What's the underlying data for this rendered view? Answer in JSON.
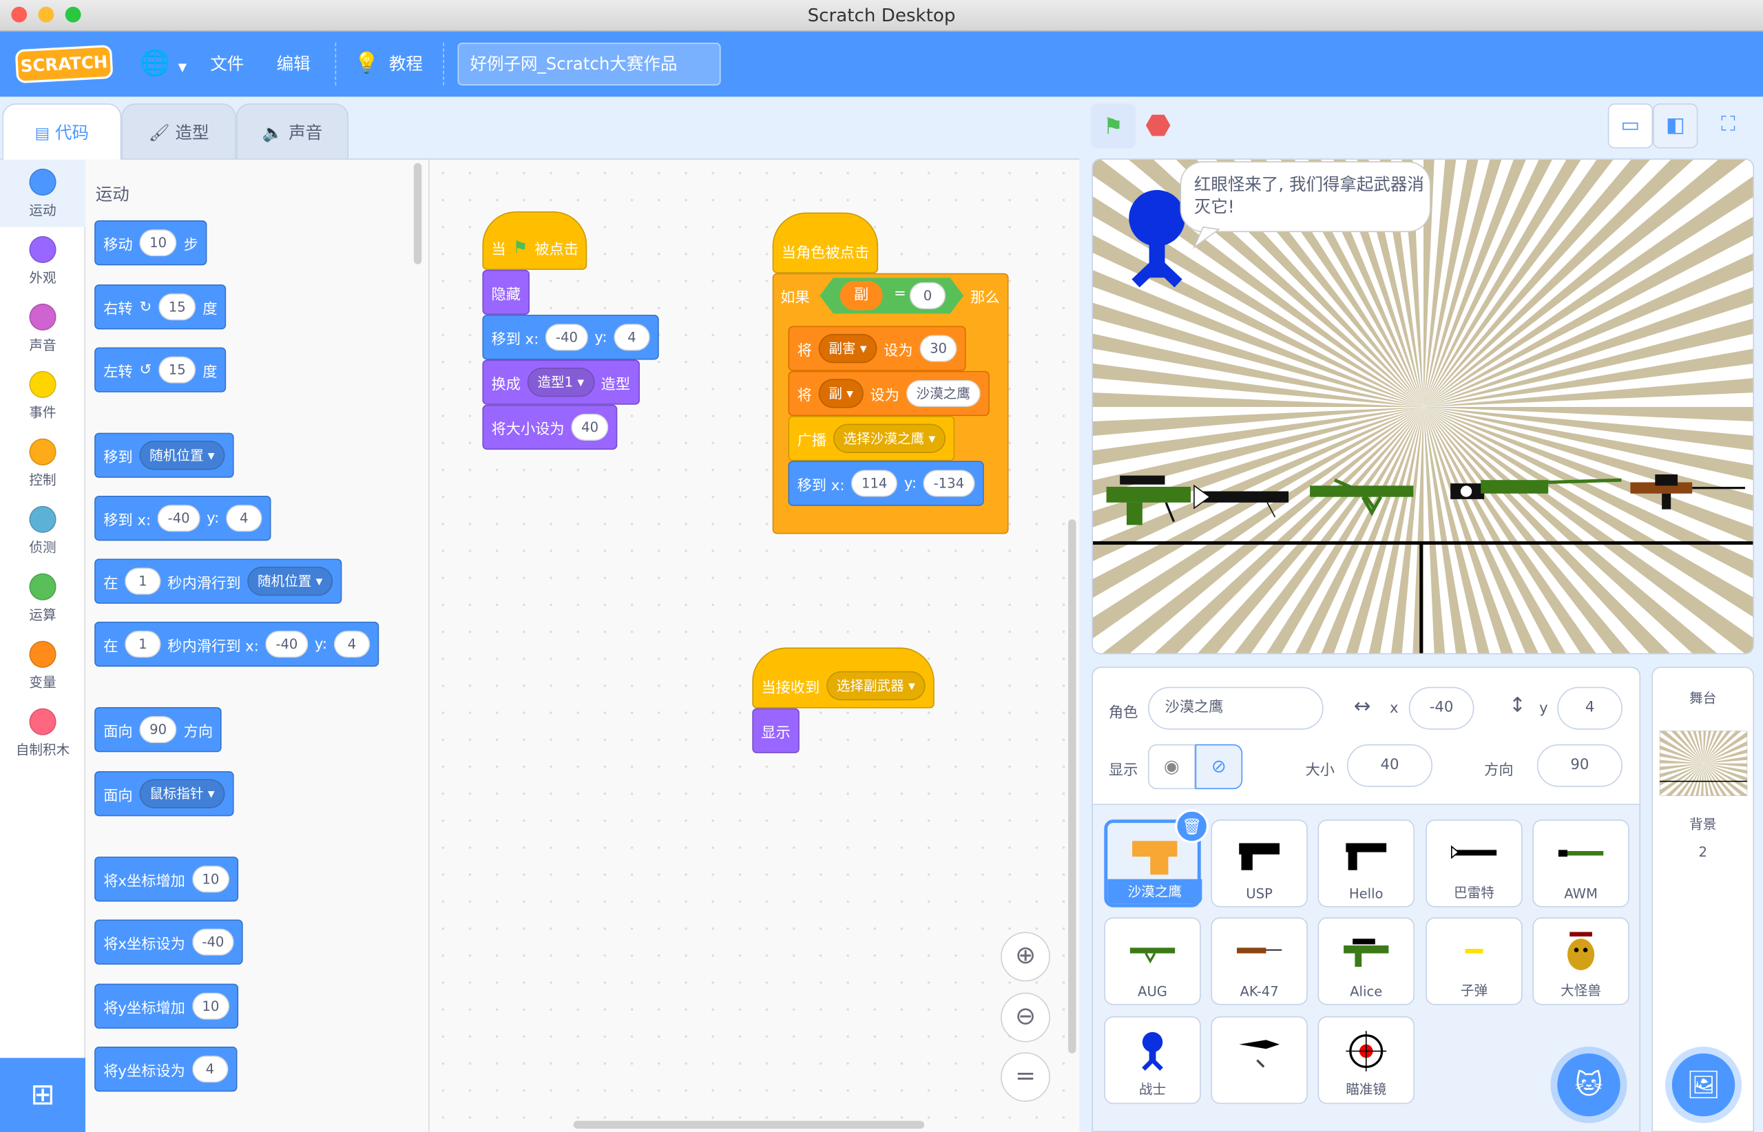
{
  "window": {
    "title": "Scratch Desktop"
  },
  "menu": {
    "logo": "SCRATCH",
    "language_icon": "globe-icon",
    "file": "文件",
    "edit": "编辑",
    "tutorials": "教程",
    "project_title": "好例子网_Scratch大赛作品"
  },
  "tabs": {
    "code": "代码",
    "costumes": "造型",
    "sounds": "声音"
  },
  "categories": [
    {
      "label": "运动",
      "color": "#4c97ff"
    },
    {
      "label": "外观",
      "color": "#9966ff"
    },
    {
      "label": "声音",
      "color": "#cf63cf"
    },
    {
      "label": "事件",
      "color": "#ffd500"
    },
    {
      "label": "控制",
      "color": "#ffab19"
    },
    {
      "label": "侦测",
      "color": "#5cb1d6"
    },
    {
      "label": "运算",
      "color": "#59c059"
    },
    {
      "label": "变量",
      "color": "#ff8c1a"
    },
    {
      "label": "自制积木",
      "color": "#ff6680"
    }
  ],
  "palette": {
    "heading": "运动",
    "move": {
      "a": "移动",
      "n": "10",
      "b": "步"
    },
    "turn_right": {
      "a": "右转",
      "n": "15",
      "b": "度"
    },
    "turn_left": {
      "a": "左转",
      "n": "15",
      "b": "度"
    },
    "goto": {
      "a": "移到",
      "dd": "随机位置"
    },
    "goto_xy": {
      "a": "移到 x:",
      "x": "-40",
      "y_label": "y:",
      "y": "4"
    },
    "glide_random": {
      "a": "在",
      "n": "1",
      "b": "秒内滑行到",
      "dd": "随机位置"
    },
    "glide_xy": {
      "a": "在",
      "n": "1",
      "b": "秒内滑行到 x:",
      "x": "-40",
      "y_label": "y:",
      "y": "4"
    },
    "point_dir": {
      "a": "面向",
      "n": "90",
      "b": "方向"
    },
    "point_towards": {
      "a": "面向",
      "dd": "鼠标指针"
    },
    "change_x": {
      "a": "将x坐标增加",
      "n": "10"
    },
    "set_x": {
      "a": "将x坐标设为",
      "n": "-40"
    },
    "change_y": {
      "a": "将y坐标增加",
      "n": "10"
    },
    "set_y": {
      "a": "将y坐标设为",
      "n": "4"
    }
  },
  "scripts": {
    "s1": {
      "hat_a": "当",
      "hat_b": "被点击",
      "hide": "隐藏",
      "goto_a": "移到 x:",
      "x": "-40",
      "y_label": "y:",
      "y": "4",
      "costume_a": "换成",
      "costume_dd": "造型1",
      "costume_b": "造型",
      "size_a": "将大小设为",
      "size": "40"
    },
    "s2": {
      "hat": "当角色被点击",
      "if_a": "如果",
      "var": "副",
      "eq": "=",
      "val": "0",
      "then": "那么",
      "set1_a": "将",
      "set1_dd": "副害",
      "set1_b": "设为",
      "set1_v": "30",
      "set2_a": "将",
      "set2_dd": "副",
      "set2_b": "设为",
      "set2_v": "沙漠之鹰",
      "bc_a": "广播",
      "bc_dd": "选择沙漠之鹰",
      "goto_a": "移到 x:",
      "x": "114",
      "y_label": "y:",
      "y": "-134"
    },
    "s3": {
      "hat_a": "当接收到",
      "hat_dd": "选择副武器",
      "show": "显示"
    }
  },
  "stage": {
    "speech": "红眼怪来了, 我们得拿起武器消灭它!"
  },
  "sprite_info": {
    "sprite_label": "角色",
    "sprite_name": "沙漠之鹰",
    "x_label": "x",
    "x": "-40",
    "y_label": "y",
    "y": "4",
    "show_label": "显示",
    "size_label": "大小",
    "size": "40",
    "dir_label": "方向",
    "dir": "90"
  },
  "sprites": [
    "沙漠之鹰",
    "USP",
    "Hello",
    "巴雷特",
    "AWM",
    "AUG",
    "AK-47",
    "Alice",
    "子弹",
    "大怪兽",
    "战士",
    "",
    "瞄准镜"
  ],
  "stage_pane": {
    "title": "舞台",
    "backdrops_label": "背景",
    "backdrops_count": "2"
  },
  "colors": {
    "accent": "#4c97ff",
    "motion": "#4c97ff",
    "looks": "#9966ff",
    "events": "#ffbf00",
    "control": "#ffab19",
    "variables": "#ff8c1a",
    "operators": "#59c059"
  }
}
